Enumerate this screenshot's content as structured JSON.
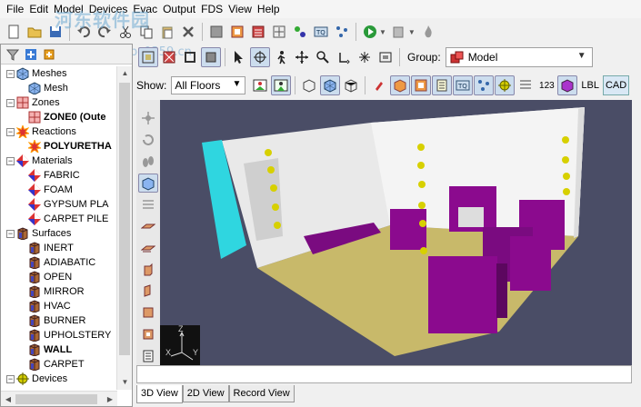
{
  "menu": [
    "File",
    "Edit",
    "Model",
    "Devices",
    "Evac",
    "Output",
    "FDS",
    "View",
    "Help"
  ],
  "watermark": {
    "title": "河东软件园",
    "url": "www.pc0359.cn"
  },
  "group": {
    "label": "Group:",
    "value": "Model"
  },
  "show": {
    "label": "Show:",
    "floor": "All Floors",
    "buttons": [
      "LBL",
      "CAD"
    ],
    "numbers": "123"
  },
  "tree": [
    {
      "label": "Meshes",
      "level": 0,
      "expanded": true,
      "icon": "mesh-icon"
    },
    {
      "label": "Mesh",
      "level": 1,
      "icon": "mesh-icon"
    },
    {
      "label": "Zones",
      "level": 0,
      "expanded": true,
      "icon": "zone-icon"
    },
    {
      "label": "ZONE0 (Oute",
      "level": 1,
      "bold": true,
      "icon": "zone-icon"
    },
    {
      "label": "Reactions",
      "level": 0,
      "expanded": true,
      "icon": "reaction-icon"
    },
    {
      "label": "POLYURETHA",
      "level": 1,
      "bold": true,
      "icon": "reaction-icon"
    },
    {
      "label": "Materials",
      "level": 0,
      "expanded": true,
      "icon": "material-icon"
    },
    {
      "label": "FABRIC",
      "level": 1,
      "icon": "material-icon"
    },
    {
      "label": "FOAM",
      "level": 1,
      "icon": "material-icon"
    },
    {
      "label": "GYPSUM PLA",
      "level": 1,
      "icon": "material-icon"
    },
    {
      "label": "CARPET PILE",
      "level": 1,
      "icon": "material-icon"
    },
    {
      "label": "Surfaces",
      "level": 0,
      "expanded": true,
      "icon": "surface-icon"
    },
    {
      "label": "INERT",
      "level": 1,
      "icon": "surface-icon"
    },
    {
      "label": "ADIABATIC",
      "level": 1,
      "icon": "surface-icon"
    },
    {
      "label": "OPEN",
      "level": 1,
      "icon": "surface-icon"
    },
    {
      "label": "MIRROR",
      "level": 1,
      "icon": "surface-icon"
    },
    {
      "label": "HVAC",
      "level": 1,
      "icon": "surface-icon"
    },
    {
      "label": "BURNER",
      "level": 1,
      "icon": "surface-icon"
    },
    {
      "label": "UPHOLSTERY",
      "level": 1,
      "icon": "surface-icon"
    },
    {
      "label": "WALL",
      "level": 1,
      "bold": true,
      "icon": "surface-icon"
    },
    {
      "label": "CARPET",
      "level": 1,
      "icon": "surface-icon"
    },
    {
      "label": "Devices",
      "level": 0,
      "expanded": true,
      "icon": "device-icon"
    }
  ],
  "axes": {
    "z": "Z",
    "x": "X",
    "y": "Y"
  },
  "tabs": [
    "3D View",
    "2D View",
    "Record View"
  ],
  "colors": {
    "viewport_bg": "#4a4d66",
    "floor": "#c8b96a",
    "wall": "#e9e9e9",
    "furniture": "#8b0a8e",
    "vent": "#2fd6e0",
    "device": "#d7d000"
  }
}
